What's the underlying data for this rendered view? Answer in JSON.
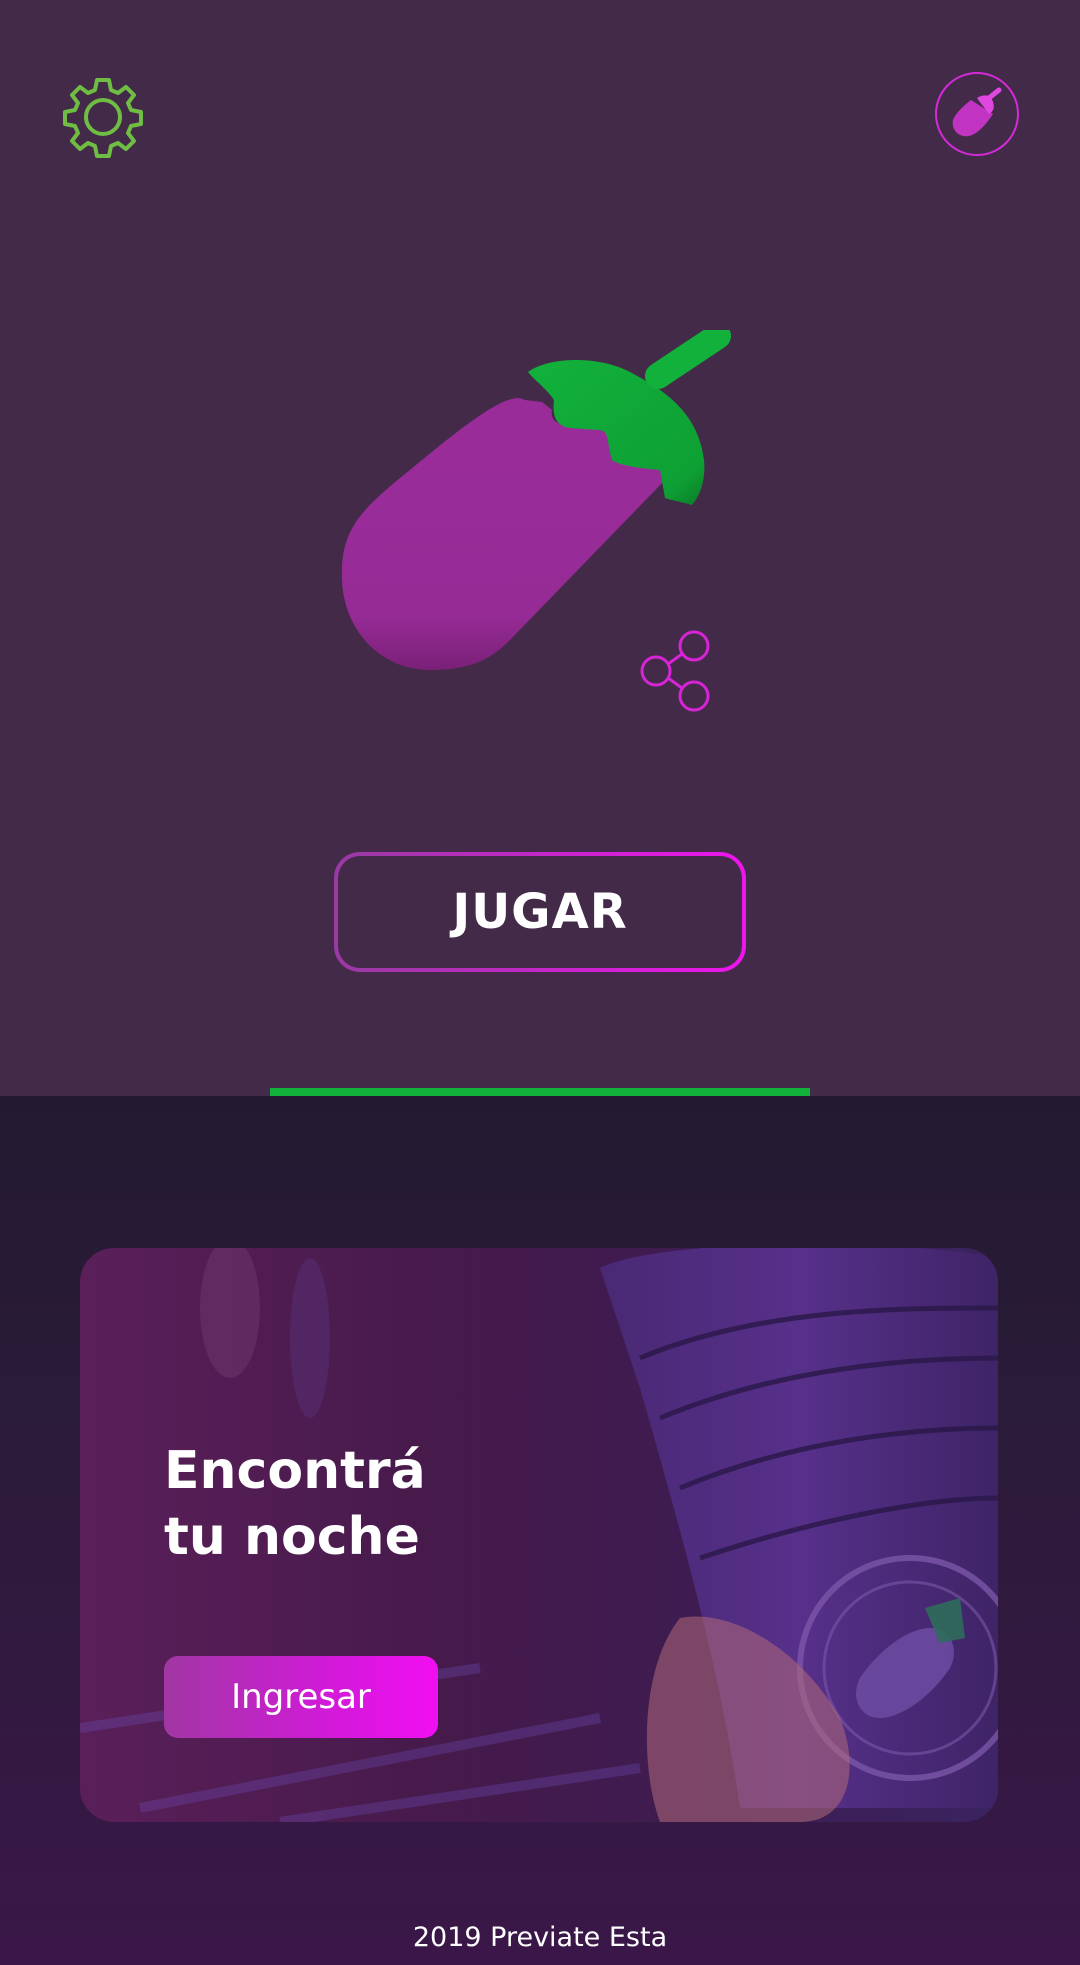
{
  "header": {
    "settings_icon": "gear-icon",
    "profile_icon": "eggplant-icon"
  },
  "hero": {
    "icon": "eggplant-icon",
    "share_icon": "share-icon"
  },
  "play_button": {
    "label": "JUGAR"
  },
  "tab_indicator": {
    "color": "#12b13c"
  },
  "promo": {
    "title_line1": "Encontrá",
    "title_line2": "tu noche",
    "button_label": "Ingresar"
  },
  "footer": {
    "text": "2019 Previate Esta"
  },
  "colors": {
    "background_top": "#432a48",
    "background_bottom": "#231a31",
    "accent_magenta": "#ee15ee",
    "accent_green": "#12b13c",
    "eggplant_purple": "#992a98"
  }
}
